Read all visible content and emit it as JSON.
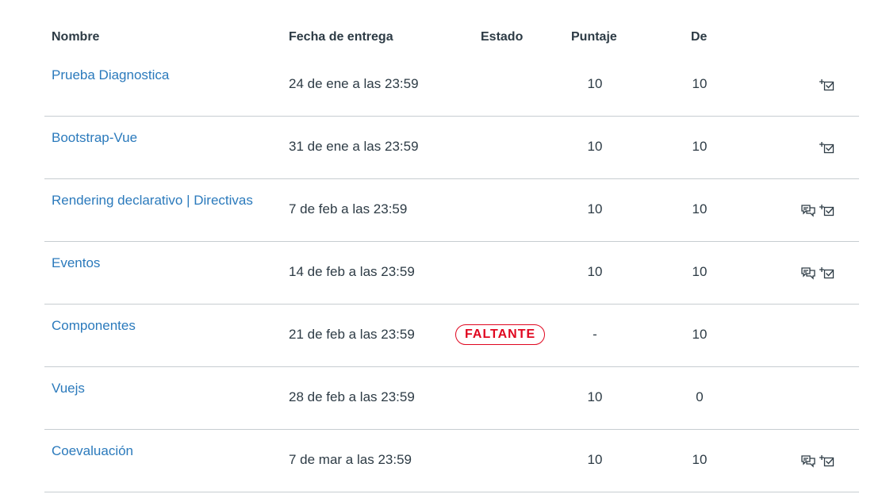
{
  "headers": {
    "name": "Nombre",
    "due": "Fecha de entrega",
    "status": "Estado",
    "score": "Puntaje",
    "out_of": "De"
  },
  "rows": [
    {
      "name": "Prueba Diagnostica",
      "due": "24 de ene a las 23:59",
      "status": "",
      "score": "10",
      "out_of": "10",
      "icons": [
        "rubric-icon"
      ]
    },
    {
      "name": "Bootstrap-Vue",
      "due": "31 de ene a las 23:59",
      "status": "",
      "score": "10",
      "out_of": "10",
      "icons": [
        "rubric-icon"
      ]
    },
    {
      "name": "Rendering declarativo | Directivas",
      "due": "7 de feb a las 23:59",
      "status": "",
      "score": "10",
      "out_of": "10",
      "icons": [
        "comments-icon",
        "rubric-icon"
      ]
    },
    {
      "name": "Eventos",
      "due": "14 de feb a las 23:59",
      "status": "",
      "score": "10",
      "out_of": "10",
      "icons": [
        "comments-icon",
        "rubric-icon"
      ]
    },
    {
      "name": "Componentes",
      "due": "21 de feb a las 23:59",
      "status": "FALTANTE",
      "score": "-",
      "out_of": "10",
      "icons": []
    },
    {
      "name": "Vuejs",
      "due": "28 de feb a las 23:59",
      "status": "",
      "score": "10",
      "out_of": "0",
      "icons": []
    },
    {
      "name": "Coevaluación",
      "due": "7 de mar a las 23:59",
      "status": "",
      "score": "10",
      "out_of": "10",
      "icons": [
        "comments-icon",
        "rubric-icon"
      ]
    }
  ],
  "colors": {
    "link": "#2b7abc",
    "text": "#2d3b45",
    "missing": "#e0061f",
    "divider": "#c7cdd1"
  }
}
